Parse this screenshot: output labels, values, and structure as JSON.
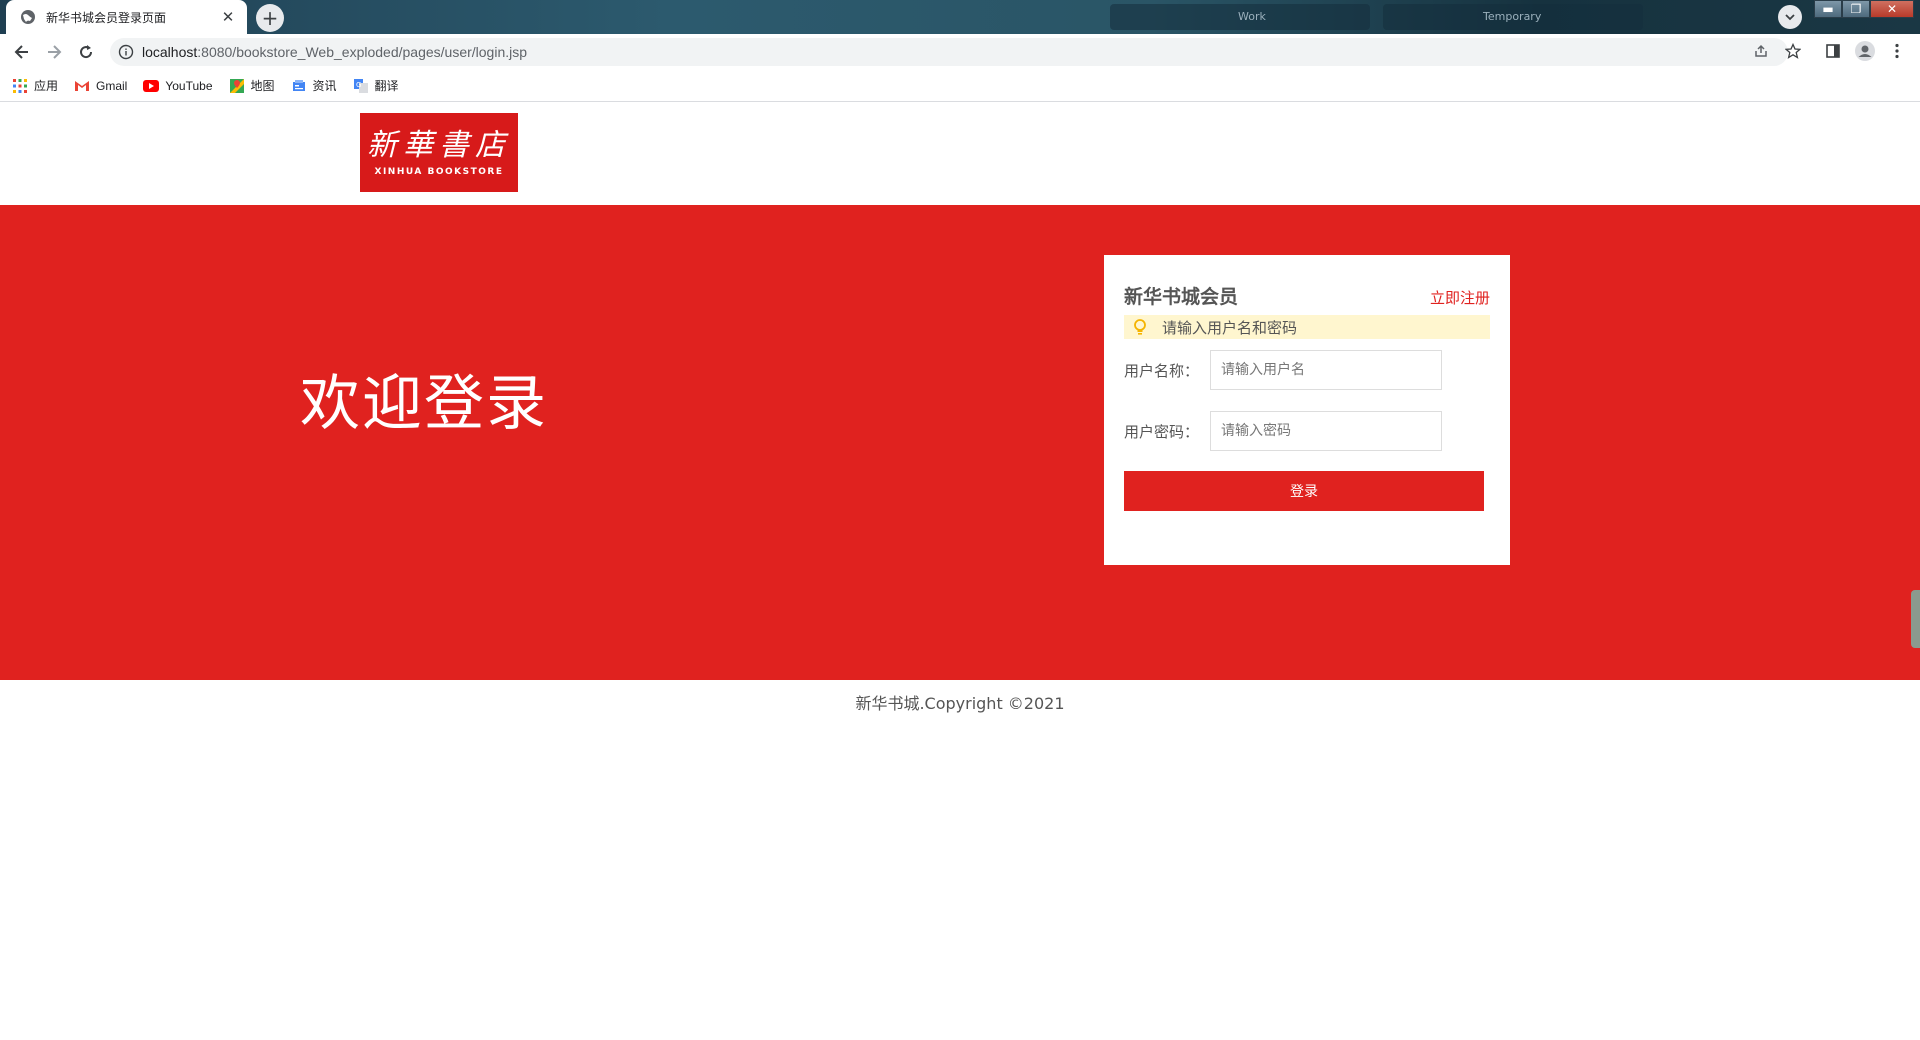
{
  "browser": {
    "tab_title": "新华书城会员登录页面",
    "url_host": "localhost",
    "url_rest": ":8080/bookstore_Web_exploded/pages/user/login.jsp",
    "bookmarks": [
      {
        "label": "应用",
        "icon": "apps-grid-icon"
      },
      {
        "label": "Gmail",
        "icon": "gmail-icon"
      },
      {
        "label": "YouTube",
        "icon": "youtube-icon"
      },
      {
        "label": "地图",
        "icon": "maps-icon"
      },
      {
        "label": "资讯",
        "icon": "news-icon"
      },
      {
        "label": "翻译",
        "icon": "translate-icon"
      }
    ],
    "background_tabs": [
      "Work",
      "Temporary"
    ],
    "accent_color": "#1a73e8"
  },
  "header": {
    "logo_cn": "新華書店",
    "logo_en": "XINHUA BOOKSTORE",
    "logo_color": "#d71a1a"
  },
  "banner": {
    "welcome_text": "欢迎登录",
    "color": "#e0221f"
  },
  "login": {
    "title": "新华书城会员",
    "register_label": "立即注册",
    "tip_text": "请输入用户名和密码",
    "username_label": "用户名称：",
    "username_placeholder": "请输入用户名",
    "password_label": "用户密码：",
    "password_placeholder": "请输入密码",
    "submit_label": "登录"
  },
  "footer": {
    "copyright": "新华书城.Copyright ©2021"
  }
}
